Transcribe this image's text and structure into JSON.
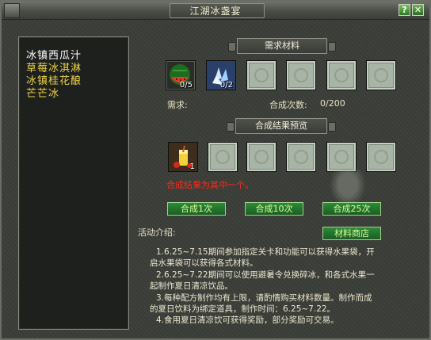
{
  "window": {
    "title": "江湖冰盏宴",
    "help_label": "?",
    "close_label": "✕"
  },
  "recipes": [
    {
      "name": "冰镇西瓜汁",
      "selected": true
    },
    {
      "name": "草莓冰淇淋",
      "selected": false
    },
    {
      "name": "冰镇桂花酿",
      "selected": false
    },
    {
      "name": "芒芒冰",
      "selected": false
    }
  ],
  "materials": {
    "header": "需求材料",
    "slots": [
      {
        "icon": "watermelon-icon",
        "count": "0/5"
      },
      {
        "icon": "ice-crystal-icon",
        "count": "0/2"
      },
      {
        "icon": "",
        "count": ""
      },
      {
        "icon": "",
        "count": ""
      },
      {
        "icon": "",
        "count": ""
      },
      {
        "icon": "",
        "count": ""
      }
    ],
    "need_label": "需求:",
    "times_label": "合成次数:",
    "times_value": "0/200"
  },
  "result": {
    "header": "合成结果预览",
    "slots": [
      {
        "icon": "juice-drink-icon",
        "count": "1"
      },
      {
        "icon": "",
        "count": ""
      },
      {
        "icon": "",
        "count": ""
      },
      {
        "icon": "",
        "count": ""
      },
      {
        "icon": "",
        "count": ""
      },
      {
        "icon": "",
        "count": ""
      }
    ],
    "note": "合成结果为其中一个。"
  },
  "buttons": {
    "craft1": "合成1次",
    "craft10": "合成10次",
    "craft25": "合成25次",
    "shop": "材料商店"
  },
  "intro": {
    "label": "活动介绍:",
    "lines": [
      "1.6.25~7.15期间参加指定关卡和功能可以获得水果袋，开",
      "启水果袋可以获得各式材料。",
      "2.6.25~7.22期间可以使用避暑令兑换碎冰，和各式水果一",
      "起制作夏日清凉饮品。",
      "3.每种配方制作均有上限，请酌情购买材料数量。制作而成",
      "的夏日饮料为绑定道具，制作时间：6.25~7.22。",
      "4.食用夏日清凉饮可获得奖励，部分奖励可交易。"
    ]
  },
  "colors": {
    "accent_green": "#2f8a3a",
    "note_red": "#ff2a1a",
    "recipe_yellow": "#ead24a"
  }
}
